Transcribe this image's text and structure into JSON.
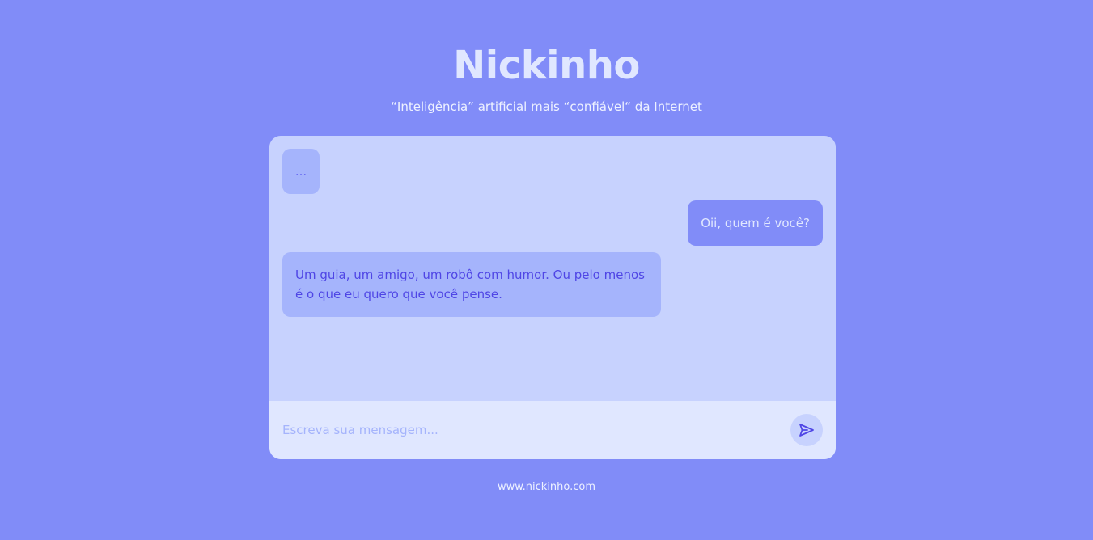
{
  "header": {
    "title": "Nickinho",
    "subtitle": "“Inteligência” artificial mais “confiável“ da Internet"
  },
  "chat": {
    "typing_indicator": "...",
    "messages": [
      {
        "role": "user",
        "text": "Oii, quem é você?"
      },
      {
        "role": "bot",
        "text": "Um guia, um amigo, um robô com humor. Ou pelo menos é o que eu quero que você pense."
      }
    ],
    "input": {
      "placeholder": "Escreva sua mensagem...",
      "value": ""
    },
    "send_icon": "send-icon"
  },
  "footer": {
    "link_text": "www.nickinho.com"
  },
  "colors": {
    "background": "#818cf8",
    "chat_area": "#c7d2fe",
    "input_bar": "#e0e7ff",
    "bot_bubble": "#a5b4fc",
    "user_bubble": "#818cf8",
    "accent": "#4f46e5"
  }
}
